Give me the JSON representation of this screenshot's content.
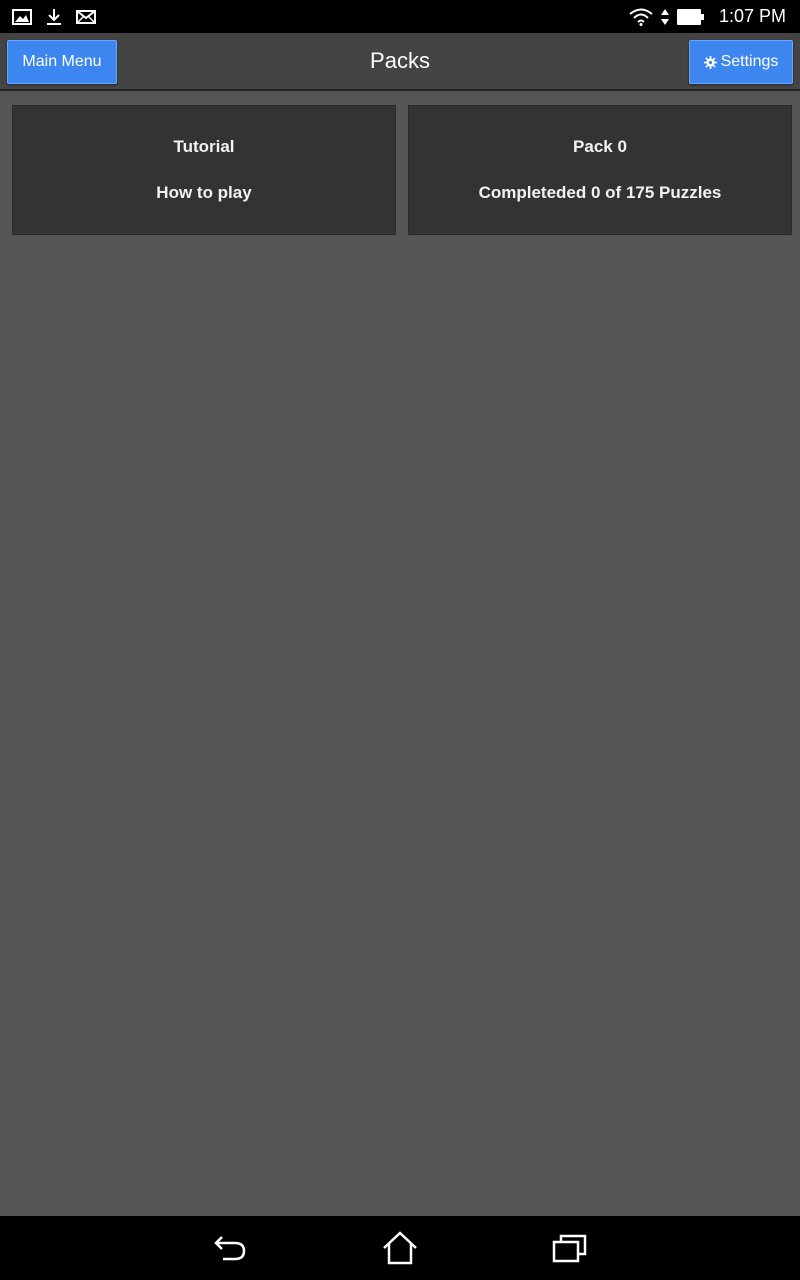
{
  "status_bar": {
    "left_icons": [
      "gallery-icon",
      "download-icon",
      "mail-icon"
    ],
    "right_icons": [
      "wifi-icon",
      "data-arrows-icon",
      "battery-icon"
    ],
    "time": "1:07 PM"
  },
  "header": {
    "main_menu_label": "Main Menu",
    "title": "Packs",
    "settings_label": "Settings",
    "settings_icon": "gear-icon",
    "accent_color": "#3d86f0"
  },
  "packs": [
    {
      "title": "Tutorial",
      "subtitle": "How to play"
    },
    {
      "title": "Pack 0",
      "subtitle": "Completeded 0 of 175 Puzzles"
    }
  ],
  "nav_bar": {
    "icons": [
      "back-icon",
      "home-icon",
      "recent-apps-icon"
    ]
  }
}
